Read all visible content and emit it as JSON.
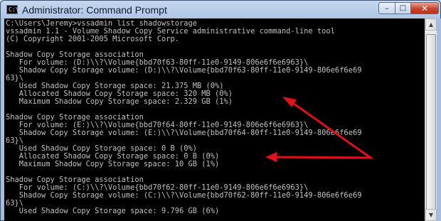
{
  "window": {
    "title": "Administrator: Command Prompt",
    "icon_label": "C:\\",
    "controls": {
      "minimize": "–",
      "maximize": "□",
      "close": "✕"
    }
  },
  "console": {
    "lines": [
      "C:\\Users\\Jeremy>vssadmin list shadowstorage",
      "vssadmin 1.1 - Volume Shadow Copy Service administrative command-line tool",
      "(C) Copyright 2001-2005 Microsoft Corp.",
      "",
      "Shadow Copy Storage association",
      "   For volume: (D:)\\\\?\\Volume{bbd70f63-80ff-11e0-9149-806e6f6e6963}\\",
      "   Shadow Copy Storage volume: (D:)\\\\?\\Volume{bbd70f63-80ff-11e0-9149-806e6f6e69",
      "63}\\",
      "   Used Shadow Copy Storage space: 21.375 MB (0%)",
      "   Allocated Shadow Copy Storage space: 320 MB (0%)",
      "   Maximum Shadow Copy Storage space: 2.329 GB (1%)",
      "",
      "Shadow Copy Storage association",
      "   For volume: (E:)\\\\?\\Volume{bbd70f64-80ff-11e0-9149-806e6f6e6963}\\",
      "   Shadow Copy Storage volume: (E:)\\\\?\\Volume{bbd70f64-80ff-11e0-9149-806e6f6e69",
      "63}\\",
      "   Used Shadow Copy Storage space: 0 B (0%)",
      "   Allocated Shadow Copy Storage space: 0 B (0%)",
      "   Maximum Shadow Copy Storage space: 10 GB (1%)",
      "",
      "Shadow Copy Storage association",
      "   For volume: (C:)\\\\?\\Volume{bbd70f62-80ff-11e0-9149-806e6f6e6963}\\",
      "   Shadow Copy Storage volume: (C:)\\\\?\\Volume{bbd70f62-80ff-11e0-9149-806e6f6e69",
      "63}\\",
      "   Used Shadow Copy Storage space: 9.796 GB (6%)"
    ]
  },
  "scrollbar": {
    "up_arrow": "▲",
    "down_arrow": "▼"
  },
  "annotation": {
    "arrow_color": "#e0101a"
  }
}
